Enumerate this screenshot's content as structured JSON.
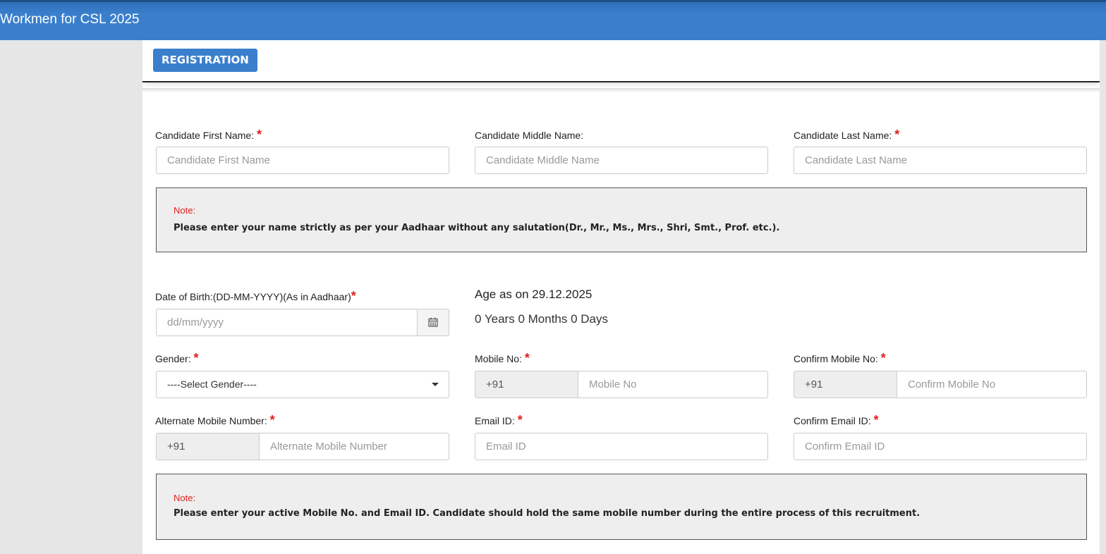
{
  "header": {
    "title": "Workmen for CSL 2025"
  },
  "tabs": {
    "registration": "REGISTRATION"
  },
  "form": {
    "first_name": {
      "label": "Candidate First Name:",
      "required": "*",
      "placeholder": "Candidate First Name"
    },
    "middle_name": {
      "label": "Candidate Middle Name:",
      "placeholder": "Candidate Middle Name"
    },
    "last_name": {
      "label": "Candidate Last Name:",
      "required": "*",
      "placeholder": "Candidate Last Name"
    },
    "note1": {
      "title": "Note:",
      "text": "Please enter your name strictly as per your Aadhaar without any salutation(Dr., Mr., Ms., Mrs., Shri, Smt., Prof. etc.)."
    },
    "dob": {
      "label": "Date of Birth:(DD-MM-YYYY)(As in Aadhaar)",
      "required": "*",
      "placeholder": "dd/mm/yyyy",
      "icon": "calendar-icon"
    },
    "age": {
      "heading": "Age as on 29.12.2025",
      "value": "0 Years 0 Months 0 Days"
    },
    "gender": {
      "label": "Gender:",
      "required": "*",
      "selected": "----Select Gender----"
    },
    "mobile": {
      "label": "Mobile No:",
      "required": "*",
      "prefix": "+91",
      "placeholder": "Mobile No"
    },
    "confirm_mobile": {
      "label": "Confirm Mobile No:",
      "required": "*",
      "prefix": "+91",
      "placeholder": "Confirm Mobile No"
    },
    "alt_mobile": {
      "label": "Alternate Mobile Number:",
      "required": "*",
      "prefix": "+91",
      "placeholder": "Alternate Mobile Number"
    },
    "email": {
      "label": "Email ID:",
      "required": "*",
      "placeholder": "Email ID"
    },
    "confirm_email": {
      "label": "Confirm Email ID:",
      "required": "*",
      "placeholder": "Confirm Email ID"
    },
    "note2": {
      "title": "Note:",
      "text": "Please enter your active Mobile No. and Email ID. Candidate should hold the same mobile number during the entire process of this recruitment."
    }
  }
}
